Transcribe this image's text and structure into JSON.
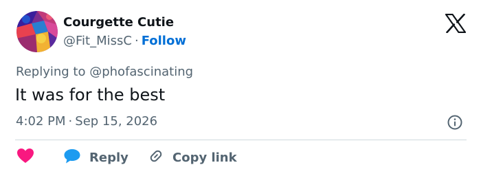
{
  "author": {
    "display_name": "Courgette Cutie",
    "handle": "@Fit_MissC",
    "separator": "·",
    "follow_label": "Follow"
  },
  "reply_context": {
    "prefix": "Replying to",
    "mention": "@phofascinating"
  },
  "tweet": {
    "text": "It was for the best",
    "time": "4:02 PM",
    "separator": "·",
    "date": "Sep 15, 2026"
  },
  "actions": {
    "like_icon": "heart-icon",
    "reply_icon": "speech-bubble-icon",
    "reply_label": "Reply",
    "copy_icon": "link-icon",
    "copy_label": "Copy link"
  },
  "icons": {
    "brand": "x-logo-icon",
    "info": "info-icon"
  },
  "colors": {
    "text_primary": "#0f1419",
    "text_secondary": "#536471",
    "link_blue": "#006fd6",
    "like_red": "#f91880",
    "reply_blue": "#1d9bf0",
    "divider": "#cfd9de"
  }
}
